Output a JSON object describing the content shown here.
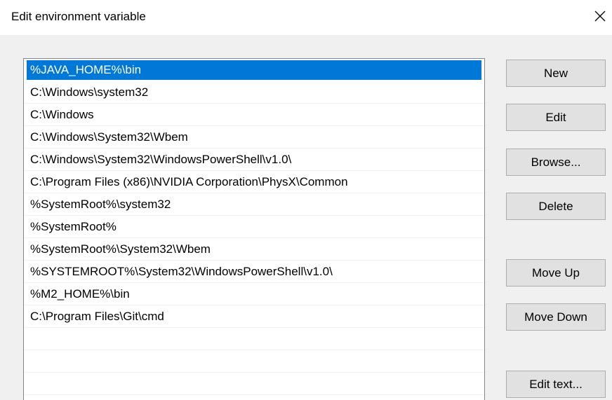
{
  "dialog": {
    "title": "Edit environment variable"
  },
  "entries": [
    "%JAVA_HOME%\\bin",
    "C:\\Windows\\system32",
    "C:\\Windows",
    "C:\\Windows\\System32\\Wbem",
    "C:\\Windows\\System32\\WindowsPowerShell\\v1.0\\",
    "C:\\Program Files (x86)\\NVIDIA Corporation\\PhysX\\Common",
    "%SystemRoot%\\system32",
    "%SystemRoot%",
    "%SystemRoot%\\System32\\Wbem",
    "%SYSTEMROOT%\\System32\\WindowsPowerShell\\v1.0\\",
    "%M2_HOME%\\bin",
    "C:\\Program Files\\Git\\cmd"
  ],
  "selected_index": 0,
  "buttons": {
    "new": "New",
    "edit": "Edit",
    "browse": "Browse...",
    "delete": "Delete",
    "move_up": "Move Up",
    "move_down": "Move Down",
    "edit_text": "Edit text..."
  },
  "icons": {
    "close": "close-icon"
  },
  "colors": {
    "selection": "#0078d7",
    "panel": "#f0f0f0",
    "button_face": "#e1e1e1"
  }
}
